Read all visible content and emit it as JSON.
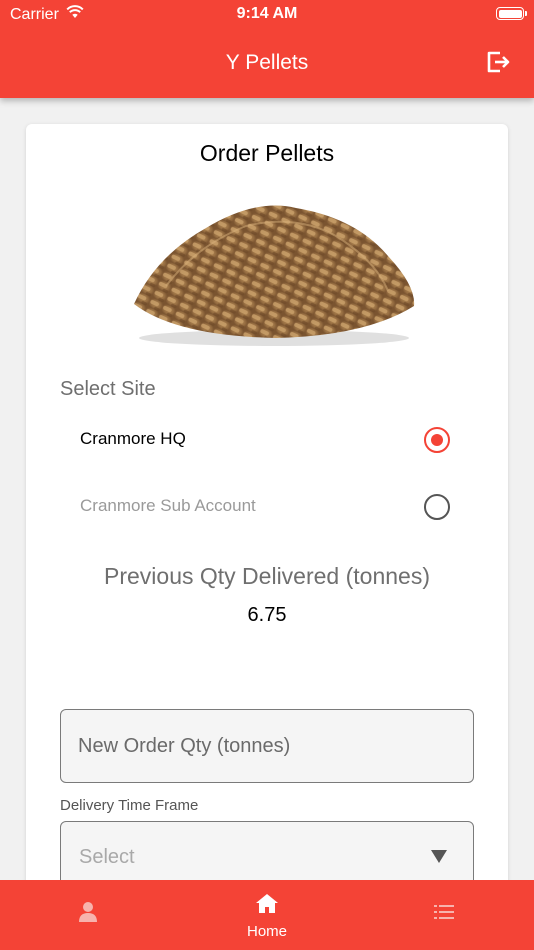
{
  "status_bar": {
    "carrier": "Carrier",
    "time": "9:14 AM"
  },
  "header": {
    "title": "Y Pellets",
    "logout_icon": "logout-icon"
  },
  "card": {
    "title": "Order Pellets",
    "image": "wood-pellets-image",
    "select_site_label": "Select Site",
    "sites": [
      {
        "label": "Cranmore HQ",
        "selected": true
      },
      {
        "label": "Cranmore Sub Account",
        "selected": false
      }
    ],
    "previous_qty_heading": "Previous Qty Delivered (tonnes)",
    "previous_qty_value": "6.75",
    "new_order_placeholder": "New Order Qty (tonnes)",
    "delivery_label": "Delivery Time Frame",
    "delivery_select_value": "Select"
  },
  "tabbar": {
    "tabs": [
      {
        "icon": "person-icon",
        "label": ""
      },
      {
        "icon": "home-icon",
        "label": "Home"
      },
      {
        "icon": "list-icon",
        "label": ""
      }
    ]
  },
  "colors": {
    "accent": "#f44336",
    "card": "#ffffff",
    "background": "#f1f1f1"
  }
}
